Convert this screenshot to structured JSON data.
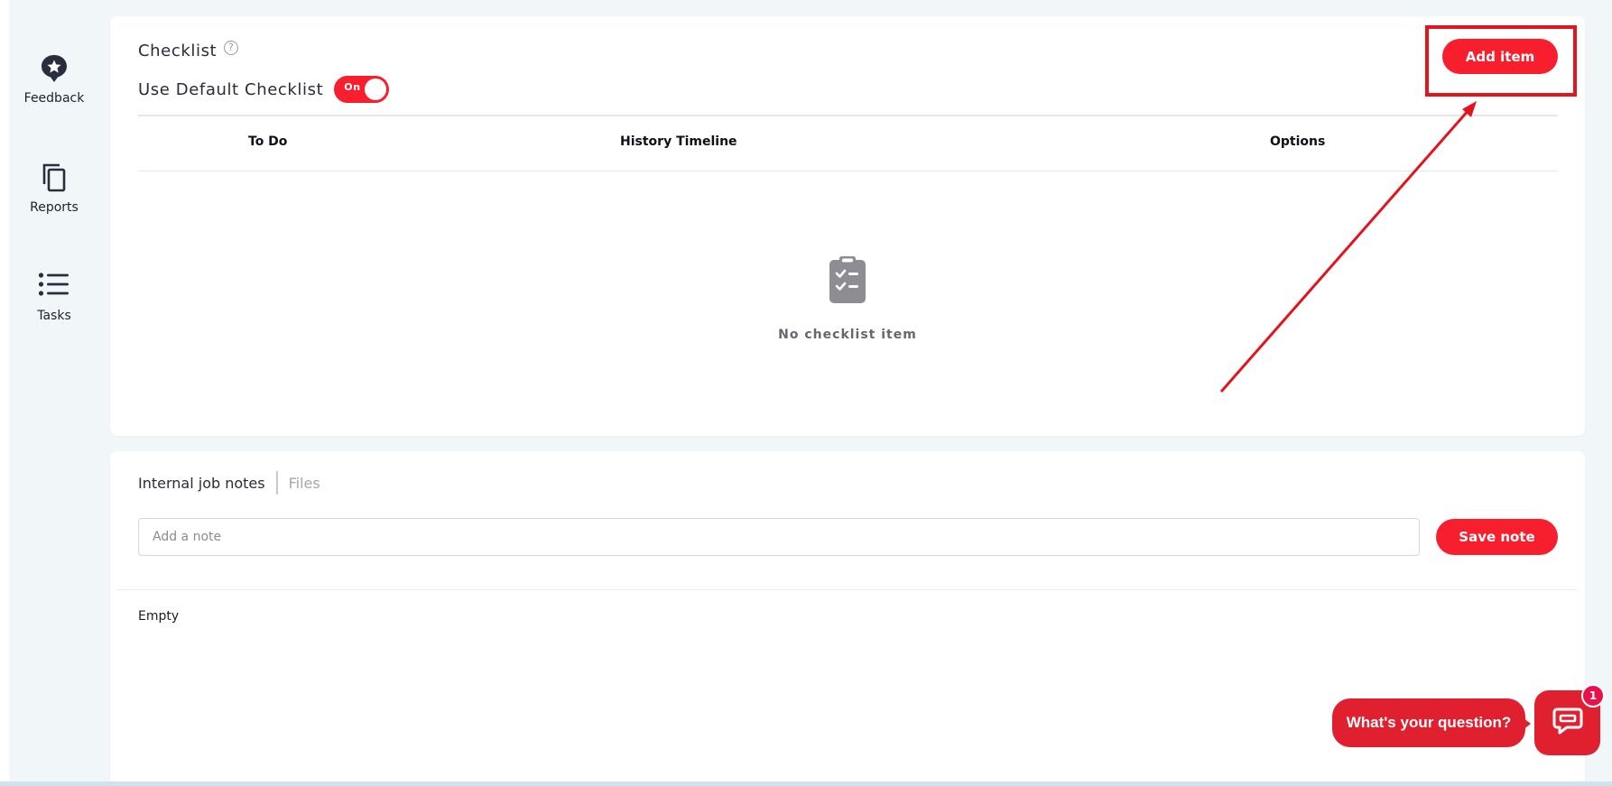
{
  "sidebar": {
    "items": [
      {
        "label": "Feedback",
        "icon": "feedback-star-icon"
      },
      {
        "label": "Reports",
        "icon": "copy-icon"
      },
      {
        "label": "Tasks",
        "icon": "list-icon"
      }
    ]
  },
  "checklist": {
    "title": "Checklist",
    "help_icon": "?",
    "default_label": "Use Default Checklist",
    "toggle_label": "On",
    "add_button": "Add item",
    "columns": [
      "To Do",
      "History Timeline",
      "Options"
    ],
    "empty_text": "No checklist item"
  },
  "notes": {
    "tabs": [
      "Internal job notes",
      "Files"
    ],
    "placeholder": "Add a note",
    "save_button": "Save note",
    "empty_text": "Empty"
  },
  "chat": {
    "prompt": "What's your question?",
    "badge_count": "1"
  },
  "colors": {
    "accent": "#f71e2e",
    "annotation": "#e3141c",
    "background": "#f1f6f8"
  }
}
